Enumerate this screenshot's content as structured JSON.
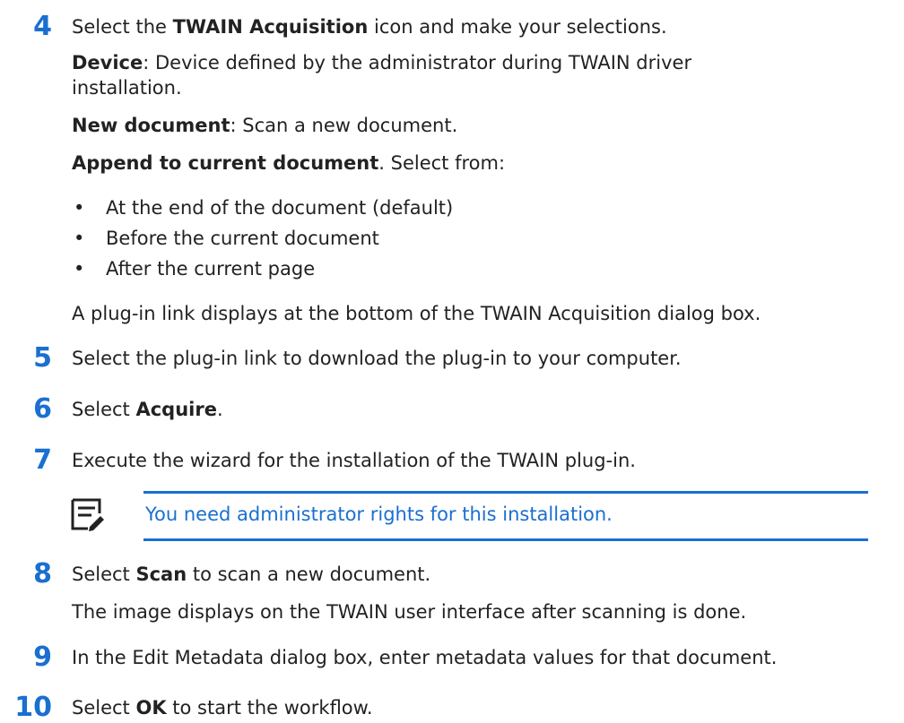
{
  "steps": [
    {
      "number": "4",
      "lead": "Select the ",
      "bold": "TWAIN Acquisition",
      "tail": " icon and make your selections.",
      "device_label": "Device",
      "device_text": ": Device defined by the administrator during TWAIN driver",
      "device_text2": "installation.",
      "newdoc_label": "New document",
      "newdoc_text": ": Scan a new document.",
      "append_label": "Append to current document",
      "append_text": ". Select from:",
      "bullets": [
        "At the end of the document (default)",
        "Before the current document",
        "After the current page"
      ],
      "footer": "A plug-in link displays at the bottom of the TWAIN Acquisition dialog box."
    },
    {
      "number": "5",
      "text": "Select the plug-in link to download the plug-in to your computer."
    },
    {
      "number": "6",
      "lead": "Select ",
      "bold": "Acquire",
      "tail": "."
    },
    {
      "number": "7",
      "text": "Execute the wizard for the installation of the TWAIN plug-in.",
      "note": "You need administrator rights for this installation."
    },
    {
      "number": "8",
      "lead": "Select ",
      "bold": "Scan",
      "tail": " to scan a new document.",
      "footer": "The image displays on the TWAIN user interface after scanning is done."
    },
    {
      "number": "9",
      "text": "In the Edit Metadata dialog box, enter metadata values for that document."
    },
    {
      "number": "10",
      "lead": "Select ",
      "bold": "OK",
      "tail": " to start the workflow."
    }
  ],
  "colors": {
    "accent": "#1a6fd0",
    "text": "#222222"
  },
  "icons": {
    "note": "note-pencil-icon"
  }
}
